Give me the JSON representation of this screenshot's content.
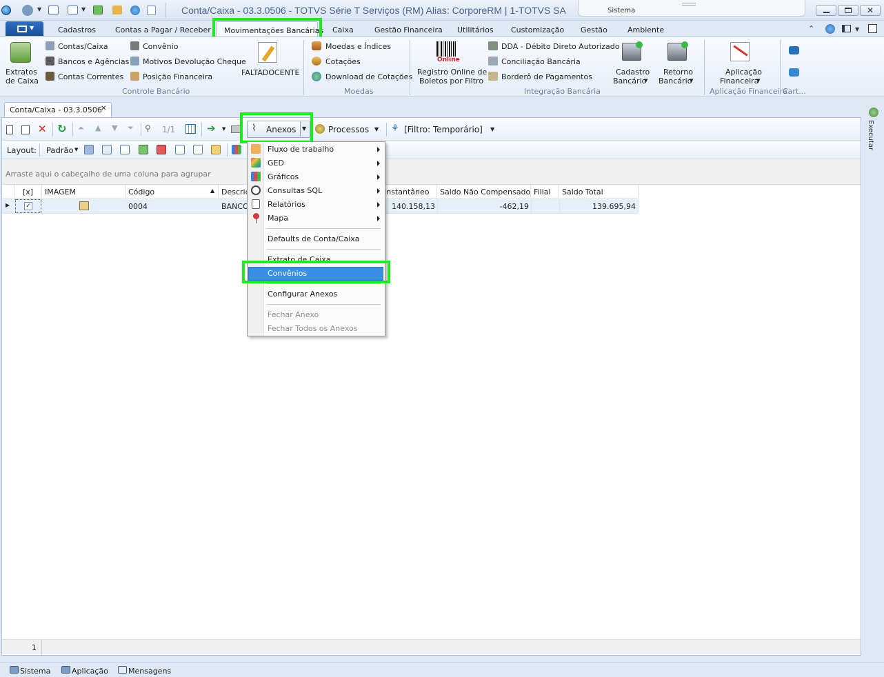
{
  "window": {
    "title": "Conta/Caixa - 03.3.0506 - TOTVS Série T Serviços (RM) Alias: CorporeRM | 1-TOTVS SA",
    "system_label": "Sistema"
  },
  "ribbon_tabs": [
    "Cadastros",
    "Contas a Pagar / Receber",
    "Movimentações Bancárias",
    "Caixa",
    "Gestão Financeira",
    "Utilitários",
    "Customização",
    "Gestão",
    "Ambiente"
  ],
  "ribbon": {
    "extratos": "Extratos de Caixa",
    "extratos_l1": "Extratos",
    "extratos_l2": "de Caixa",
    "contas_caixa": "Contas/Caixa",
    "bancos_agencias": "Bancos e Agências",
    "contas_correntes": "Contas Correntes",
    "convenio": "Convênio",
    "motivos_devolucao": "Motivos Devolução Cheque",
    "posicao_financeira": "Posição Financeira",
    "faltadocente": "FALTADOCENTE",
    "group_controle": "Controle Bancário",
    "moedas_indices": "Moedas e Índices",
    "cotacoes": "Cotações",
    "download_cotacoes": "Download de Cotações",
    "group_moedas": "Moedas",
    "online_label": "Online",
    "registro_l1": "Registro Online de",
    "registro_l2": "Boletos por Filtro",
    "dda": "DDA - Débito Direto Autorizado",
    "conciliacao": "Conciliação Bancária",
    "bordero": "Borderô de Pagamentos",
    "cadastro_l1": "Cadastro",
    "cadastro_l2": "Bancário",
    "retorno_l1": "Retorno",
    "retorno_l2": "Bancário",
    "group_integracao": "Integração Bancária",
    "aplicacao_l1": "Aplicação",
    "aplicacao_l2": "Financeira",
    "group_aplicacao": "Aplicação Financeira",
    "group_cart": "Cart..."
  },
  "doc_tab": {
    "label": "Conta/Caixa - 03.3.0506",
    "close": "✕"
  },
  "toolbar": {
    "pager": "1/1",
    "anexos": "Anexos",
    "processos": "Processos",
    "filtro": "[Filtro: Temporário]"
  },
  "layout_bar": {
    "label": "Layout:",
    "preset": "Padrão"
  },
  "group_hint": "Arraste aqui o cabeçalho de uma coluna para agrupar",
  "grid": {
    "headers": [
      "[x]",
      "IMAGEM",
      "Código",
      "Descriçã",
      "Instantâneo",
      "Saldo Não Compensado",
      "Filial",
      "Saldo Total"
    ],
    "rows": [
      {
        "codigo": "0004",
        "descricao": "BANCO",
        "instantaneo": "140.158,13",
        "saldo_nao_compensado": "-462,19",
        "filial": "",
        "saldo_total": "139.695,94"
      }
    ],
    "footer_count": "1"
  },
  "anexos_menu": {
    "items": [
      "Fluxo de trabalho",
      "GED",
      "Gráficos",
      "Consultas SQL",
      "Relatórios",
      "Mapa"
    ],
    "defaults": "Defaults de Conta/Caixa",
    "extrato": "Extrato de Caixa",
    "convenios": "Convênios",
    "configurar": "Configurar Anexos",
    "fechar": "Fechar Anexo",
    "fechar_todos": "Fechar Todos os Anexos"
  },
  "side_panel": {
    "executar": "Executar"
  },
  "statusbar": [
    "Sistema",
    "Aplicação",
    "Mensagens"
  ],
  "colors": {
    "highlight": "#22e822",
    "menu_selected": "#3a8ee6",
    "title_text": "#46658f"
  }
}
